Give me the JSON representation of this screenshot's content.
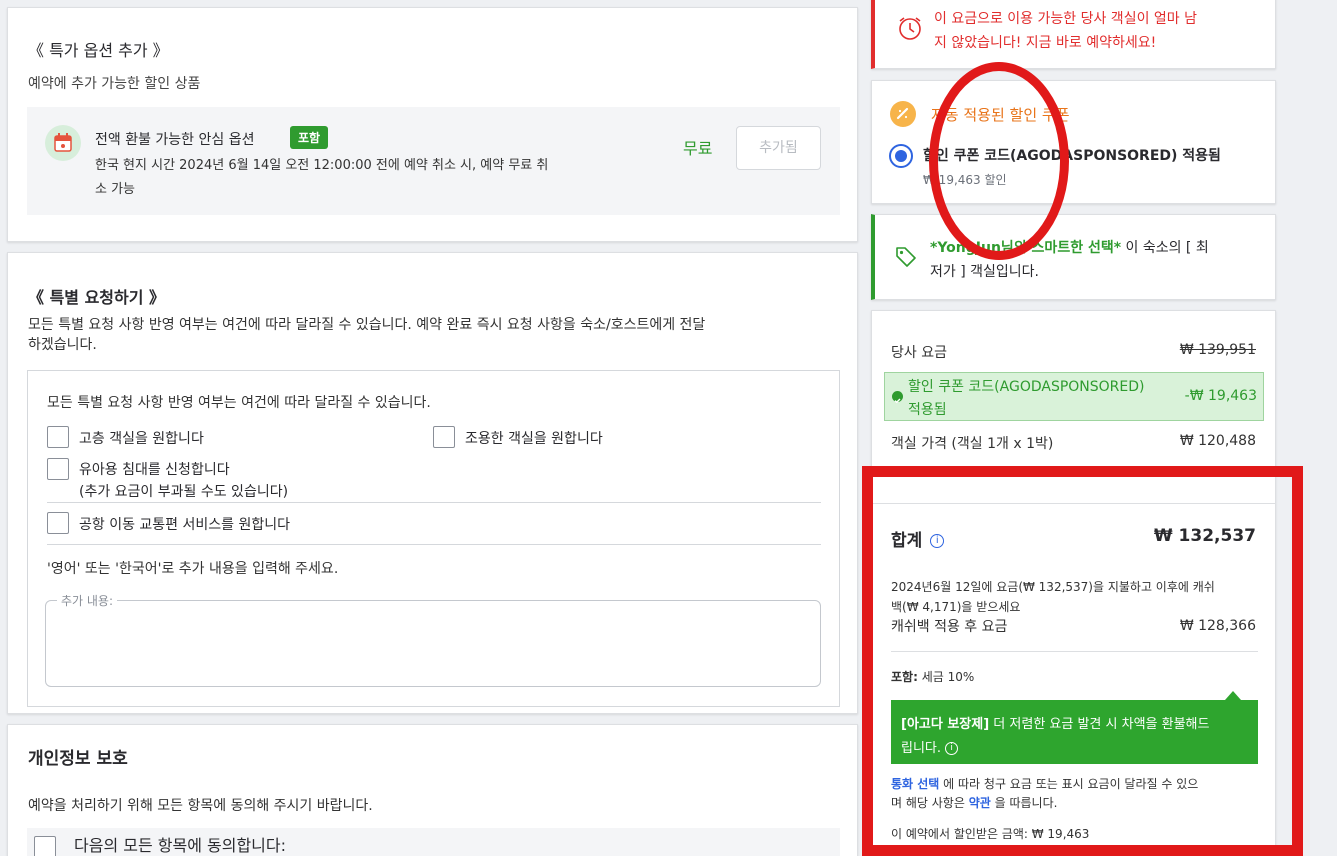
{
  "extra_options": {
    "title": "《 특가 옵션 추가 》",
    "subtitle": "예약에 추가 가능한 할인 상품",
    "option": {
      "name": "전액 환불 가능한 안심 옵션",
      "badge": "포함",
      "desc_line1": "한국 현지 시간 2024년 6월 14일 오전 12:00:00 전에 예약 취소 시, 예약 무료 취",
      "desc_line2": "소 가능",
      "price": "무료",
      "button": "추가됨"
    }
  },
  "special_requests": {
    "title": "《 특별 요청하기 》",
    "desc_line1": "모든 특별 요청 사항 반영 여부는 여건에 따라 달라질 수 있습니다. 예약 완료 즉시 요청 사항을 숙소/호스트에게 전달",
    "desc_line2": "하겠습니다.",
    "inner_note": "모든 특별 요청 사항 반영 여부는 여건에 따라 달라질 수 있습니다.",
    "options": {
      "high_floor": "고층 객실을 원합니다",
      "quiet_room": "조용한 객실을 원합니다",
      "baby_cot": "유아용 침대를 신청합니다",
      "baby_cot_note": "(추가 요금이 부과될 수도 있습니다)",
      "airport": "공항 이동 교통편 서비스를 원합니다"
    },
    "language_note": "'영어' 또는 '한국어'로 추가 내용을 입력해 주세요.",
    "textarea_label": "추가 내용:"
  },
  "privacy": {
    "title": "개인정보 보호",
    "desc": "예약을 처리하기 위해 모든 항목에 동의해 주시기 바랍니다.",
    "agree_all": "다음의 모든 항목에 동의합니다:"
  },
  "sidebar": {
    "urgency": {
      "line1": "이 요금으로 이용 가능한 당사 객실이 얼마 남",
      "line2": "지 않았습니다! 지금 바로 예약하세요!"
    },
    "coupon": {
      "title": "자동 적용된 할인 쿠폰",
      "code_label": "할인 쿠폰 코드(AGODASPONSORED) 적용됨",
      "discount": "₩ 19,463 할인"
    },
    "smart": {
      "name": "*YongJun님의 스마트한 선택*",
      "rest1": " 이 숙소의 [ 최",
      "line2": "저가 ] 객실입니다."
    },
    "price": {
      "base_label": "당사 요금",
      "base_value": "₩ 139,951",
      "coupon_line1": "할인 쿠폰 코드(AGODASPONSORED)",
      "coupon_line2": "적용됨",
      "coupon_value": "-₩ 19,463",
      "room_label": "객실 가격 (객실 1개 x 1박)",
      "room_value": "₩ 120,488",
      "total_label": "합계",
      "total_value": "₩ 132,537",
      "cashback_line1": "2024년6월 12일에 요금(₩ 132,537)을 지불하고 이후에 캐쉬",
      "cashback_line2": "백(₩ 4,171)을 받으세요",
      "after_label": "캐쉬백 적용 후 요금",
      "after_value": "₩ 128,366",
      "tax_prefix": "포함:",
      "tax_value": " 세금 10%",
      "guarantee_bold": "[아고다 보장제]",
      "guarantee_rest": " 더 저렴한 요금 발견 시 차액을 환불해드",
      "guarantee_line2": "립니다.",
      "currency_link": "통화 선택",
      "currency_rest": " 에 따라 청구 요금 또는 표시 요금이 달라질 수 있으",
      "currency_line2a": "며 해당 사항은 ",
      "terms_link": "약관",
      "currency_line2b": " 을 따릅니다.",
      "saved": "이 예약에서 할인받은 금액: ₩ 19,463"
    }
  }
}
